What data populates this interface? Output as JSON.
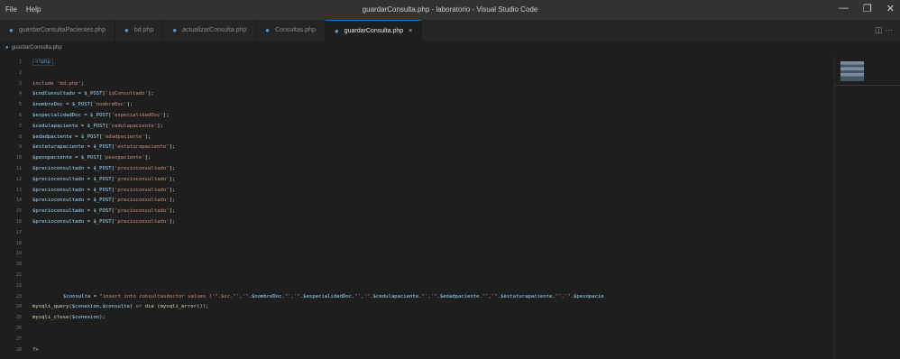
{
  "titlebar": {
    "menu": [
      "File",
      "Help"
    ],
    "title": "guardarConsulta.php - laboratorio - Visual Studio Code",
    "controls": [
      "—",
      "❐",
      "✕"
    ]
  },
  "tabs": [
    {
      "label": "guardarConsultaPacientes.php",
      "active": false
    },
    {
      "label": "bd.php",
      "active": false
    },
    {
      "label": "actualizarConsulta.php",
      "active": false
    },
    {
      "label": "Consultas.php",
      "active": false
    },
    {
      "label": "guardarConsulta.php",
      "active": true,
      "close": "×"
    }
  ],
  "tabs_end": "◫ ···",
  "breadcrumb": "guardarConsulta.php",
  "lines": [
    {
      "n": "1",
      "html": "<span class='phpbox'>&lt;?php</span>"
    },
    {
      "n": "2",
      "html": ""
    },
    {
      "n": "3",
      "html": "<span class='kw'>include</span> <span class='str'>'bd.php'</span><span class='op'>;</span>"
    },
    {
      "n": "4",
      "html": "<span class='var'>$codConsultado</span> <span class='op'>= </span><span class='var'>$_POST</span><span class='op'>[</span><span class='str'>'idConsultado'</span><span class='op'>];</span>"
    },
    {
      "n": "5",
      "html": "<span class='var'>$nombreDoc</span> <span class='op'>= </span><span class='var'>$_POST</span><span class='op'>[</span><span class='str'>'nombreDoc'</span><span class='op'>];</span>"
    },
    {
      "n": "6",
      "html": "<span class='var'>$especialidadDoc</span> <span class='op'>= </span><span class='var'>$_POST</span><span class='op'>[</span><span class='str'>'especialidadDoc'</span><span class='op'>];</span>"
    },
    {
      "n": "7",
      "html": "<span class='var'>$cedulapaciente</span> <span class='op'>= </span><span class='var'>$_POST</span><span class='op'>[</span><span class='str'>'cedulapaciente'</span><span class='op'>];</span>"
    },
    {
      "n": "8",
      "html": "<span class='var'>$edadpaciente</span> <span class='op'>= </span><span class='var'>$_POST</span><span class='op'>[</span><span class='str'>'edadpaciente'</span><span class='op'>];</span>"
    },
    {
      "n": "9",
      "html": "<span class='var'>$estaturapaciente</span> <span class='op'>= </span><span class='var'>$_POST</span><span class='op'>[</span><span class='str'>'estaturapaciente'</span><span class='op'>];</span>"
    },
    {
      "n": "10",
      "html": "<span class='var'>$pesopaciente</span> <span class='op'>= </span><span class='var'>$_POST</span><span class='op'>[</span><span class='str'>'pesopaciente'</span><span class='op'>];</span>"
    },
    {
      "n": "11",
      "html": "<span class='var'>$precioconsultado</span> <span class='op'>= </span><span class='var'>$_POST</span><span class='op'>[</span><span class='str'>'precioconsultado'</span><span class='op'>];</span>"
    },
    {
      "n": "12",
      "html": "<span class='var'>$precioconsultado</span> <span class='op'>= </span><span class='var'>$_POST</span><span class='op'>[</span><span class='str'>'precioconsultado'</span><span class='op'>];</span>"
    },
    {
      "n": "13",
      "html": "<span class='var'>$precioconsultado</span> <span class='op'>= </span><span class='var'>$_POST</span><span class='op'>[</span><span class='str'>'precioconsultado'</span><span class='op'>];</span>"
    },
    {
      "n": "14",
      "html": "<span class='var'>$precioconsultado</span> <span class='op'>= </span><span class='var'>$_POST</span><span class='op'>[</span><span class='str'>'precioconsultado'</span><span class='op'>];</span>"
    },
    {
      "n": "15",
      "html": "<span class='var'>$precioconsultado</span> <span class='op'>= </span><span class='var'>$_POST</span><span class='op'>[</span><span class='str'>'precioconsultado'</span><span class='op'>];</span>"
    },
    {
      "n": "16",
      "html": "<span class='var'>$precioconsultado</span> <span class='op'>= </span><span class='var'>$_POST</span><span class='op'>[</span><span class='str'>'precioconsultado'</span><span class='op'>];</span>"
    },
    {
      "n": "17",
      "html": ""
    },
    {
      "n": "18",
      "html": ""
    },
    {
      "n": "19",
      "html": ""
    },
    {
      "n": "20",
      "html": ""
    },
    {
      "n": "21",
      "html": ""
    },
    {
      "n": "22",
      "html": ""
    },
    {
      "n": "23",
      "long": true,
      "html": "<span class='var'>$consulta</span> <span class='op'>= </span><span class='str'>\"insert into consultasdoctor values ('\".$cc.\"','\"</span><span class='op'>.</span><span class='var'>$nombreDoc</span><span class='op'>.</span><span class='str'>\"','\"</span><span class='op'>.</span><span class='var'>$especialidadDoc</span><span class='op'>.</span><span class='str'>\"','\"</span><span class='op'>.</span><span class='var'>$cedulapaciente</span><span class='op'>.</span><span class='str'>\"','\"</span><span class='op'>.</span><span class='var'>$edadpaciente</span><span class='op'>.</span><span class='str'>\"','\"</span><span class='op'>.</span><span class='var'>$estaturapaciente</span><span class='op'>.</span><span class='str'>\"','\"</span><span class='op'>.</span><span class='var'>$pesopacie</span>"
    },
    {
      "n": "24",
      "html": "<span class='fn'>mysqli_query</span><span class='op'>(</span><span class='var'>$conexion</span><span class='op'>,</span><span class='var'>$consulta</span><span class='op'>) </span><span class='kw'>or</span> <span class='fn'>die</span> <span class='op'>(</span><span class='fn'>mysqli_error</span><span class='op'>());</span>"
    },
    {
      "n": "25",
      "html": "<span class='fn'>mysqli_close</span><span class='op'>(</span><span class='var'>$conexion</span><span class='op'>);</span>"
    },
    {
      "n": "26",
      "html": ""
    },
    {
      "n": "27",
      "html": ""
    },
    {
      "n": "28",
      "html": "<span class='op'>?&gt;</span>"
    }
  ]
}
